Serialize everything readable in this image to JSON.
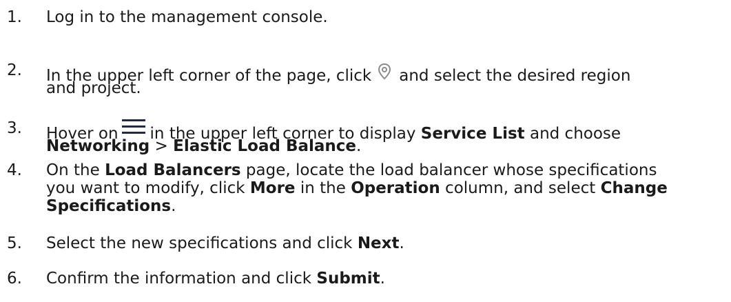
{
  "steps": [
    {
      "number": "1.",
      "line1": "Log in to the management console."
    },
    {
      "number": "2.",
      "line1_a": "In the upper left corner of the page, click",
      "icon": "location-pin-icon",
      "line1_b": "and select the desired region",
      "line2": "and project."
    },
    {
      "number": "3.",
      "line1_a": "Hover on",
      "icon": "menu-hamburger-icon",
      "line1_b": "in the upper left corner to display",
      "line1_c": "Service List",
      "line1_d": "and choose",
      "line2_a": "Networking",
      "line2_b": ">",
      "line2_c": "Elastic Load Balance",
      "line2_d": "."
    },
    {
      "number": "4.",
      "line1_a": "On the",
      "line1_b": "Load Balancers",
      "line1_c": "page, locate the load balancer whose specifications",
      "line2_a": "you want to modify, click",
      "line2_b": "More",
      "line2_c": "in the",
      "line2_d": "Operation",
      "line2_e": "column, and select",
      "line2_f": "Change",
      "line3_a": "Specifications",
      "line3_b": "."
    },
    {
      "number": "5.",
      "line1_a": "Select the new specifications and click",
      "line1_b": "Next",
      "line1_c": "."
    },
    {
      "number": "6.",
      "line1_a": "Confirm the information and click",
      "line1_b": "Submit",
      "line1_c": "."
    }
  ],
  "colors": {
    "text": "#1a1a1a",
    "icon_gray": "#8a8a8a",
    "icon_navy": "#1f2a44"
  }
}
